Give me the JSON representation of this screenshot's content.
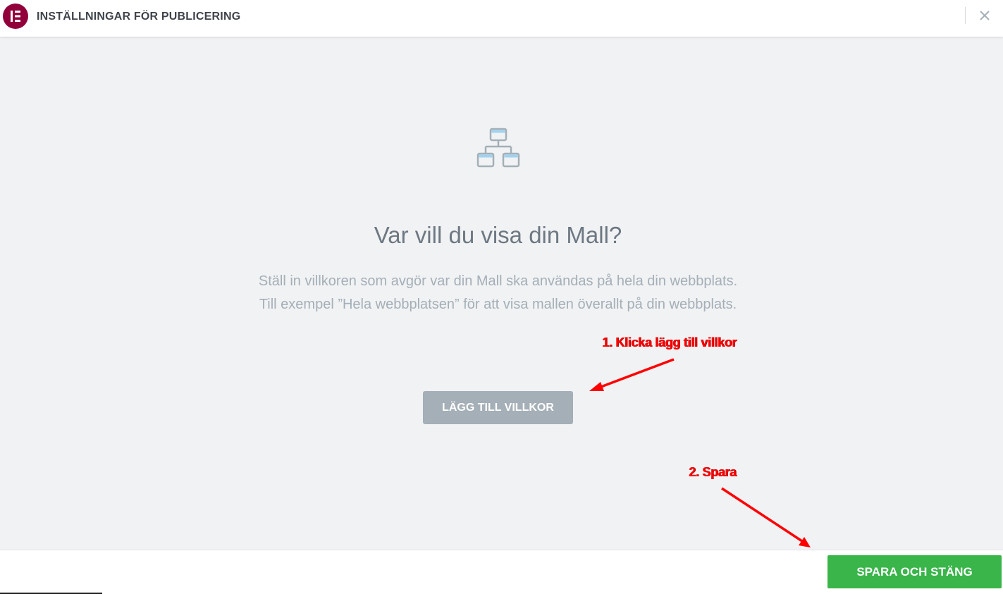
{
  "header": {
    "title": "INSTÄLLNINGAR FÖR PUBLICERING",
    "logo_icon": "elementor-logo-icon",
    "close_icon": "close-icon"
  },
  "main": {
    "icon": "site-hierarchy-icon",
    "title": "Var vill du visa din Mall?",
    "description_line1": "Ställ in villkoren som avgör var din Mall ska användas på hela din webbplats.",
    "description_line2": "Till exempel ”Hela webbplatsen” för att visa mallen överallt på din webbplats.",
    "add_condition_label": "LÄGG TILL VILLKOR"
  },
  "annotations": {
    "step1": "1. Klicka lägg till villkor",
    "step2": "2. Spara",
    "color": "#ff0000"
  },
  "footer": {
    "save_close_label": "SPARA OCH STÄNG"
  },
  "colors": {
    "brand": "#92003b",
    "save_button": "#39b54a",
    "secondary_button": "#a4afb7"
  }
}
